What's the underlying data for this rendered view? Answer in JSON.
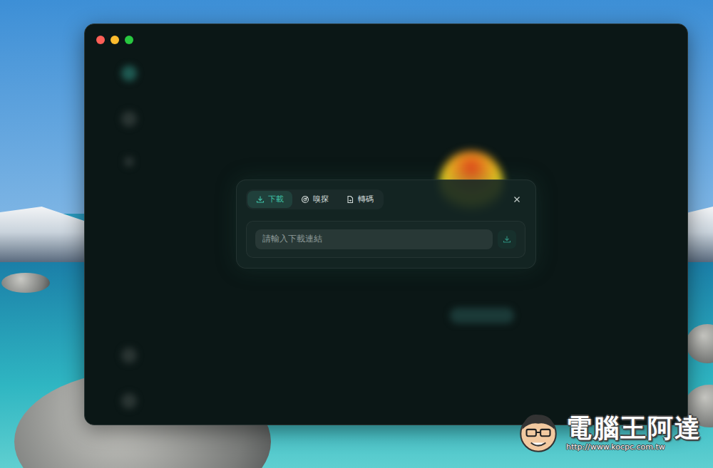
{
  "dialog": {
    "tabs": [
      {
        "label": "下載",
        "selected": true
      },
      {
        "label": "嗅探",
        "selected": false
      },
      {
        "label": "轉碼",
        "selected": false
      }
    ],
    "input": {
      "placeholder": "請輸入下載連結"
    }
  },
  "watermark": {
    "name": "電腦王阿達",
    "url": "http://www.kocpc.com.tw"
  }
}
